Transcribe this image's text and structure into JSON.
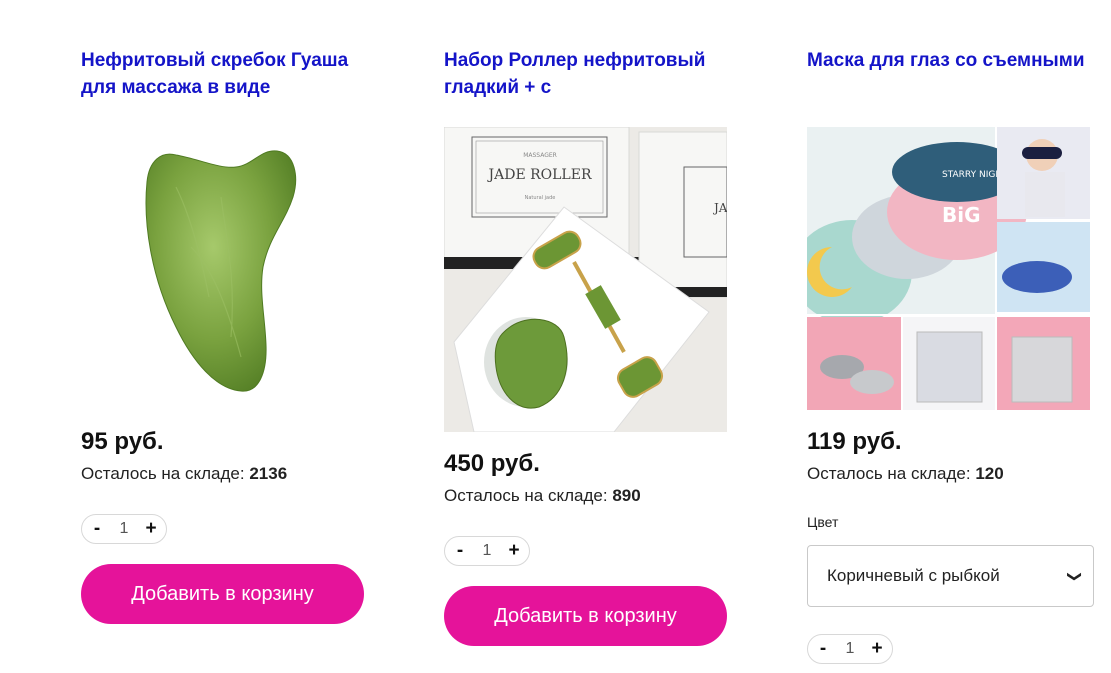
{
  "products": [
    {
      "title": "Нефритовый скребок Гуаша для массажа в виде",
      "price": "95 руб.",
      "stock_label": "Осталось на складе:",
      "stock_value": "2136",
      "qty_minus": "-",
      "qty_value": "1",
      "qty_plus": "+",
      "add_label": "Добавить в корзину"
    },
    {
      "title": "Набор Роллер нефритовый гладкий + с",
      "price": "450 руб.",
      "stock_label": "Осталось на складе:",
      "stock_value": "890",
      "qty_minus": "-",
      "qty_value": "1",
      "qty_plus": "+",
      "add_label": "Добавить в корзину",
      "box_text_main": "JADE ROLLER",
      "box_text_top": "MASSAGER",
      "box_text_bottom": "Natural jade",
      "box_text_partial": "JA"
    },
    {
      "title": "Маска для глаз со съемными",
      "price": "119 руб.",
      "stock_label": "Осталось на складе:",
      "stock_value": "120",
      "color_label": "Цвет",
      "color_selected": "Коричневый с рыбкой",
      "qty_minus": "-",
      "qty_value": "1",
      "qty_plus": "+",
      "mask_text_big": "BiG",
      "mask_text_starry": "STARRY NIGHT"
    }
  ],
  "colors": {
    "title": "#1414c8",
    "button": "#e5139a",
    "jade": "#6f9a3a"
  }
}
